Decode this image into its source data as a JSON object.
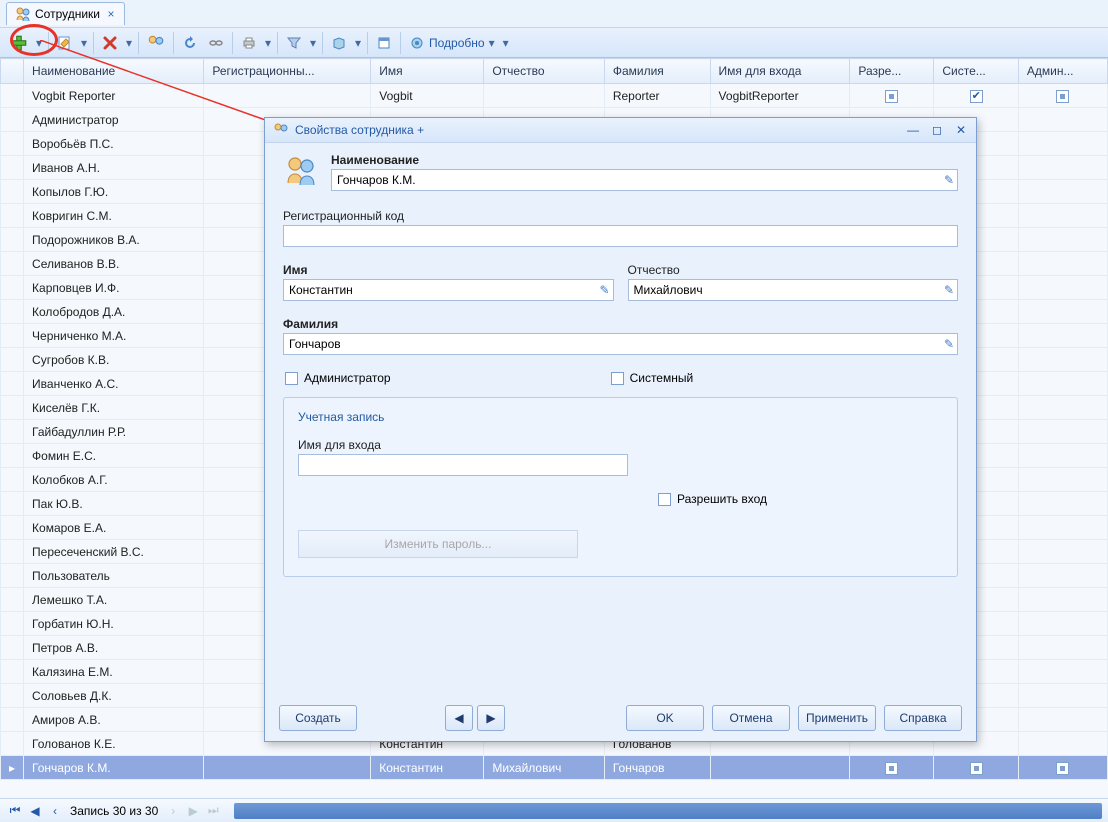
{
  "tab": {
    "label": "Сотрудники"
  },
  "toolbar": {
    "detail": "Подробно"
  },
  "columns": [
    "Наименование",
    "Регистрационны...",
    "Имя",
    "Отчество",
    "Фамилия",
    "Имя для входа",
    "Разре...",
    "Систе...",
    "Админ..."
  ],
  "rows": [
    {
      "name": "Vogbit Reporter",
      "reg": "",
      "fname": "Vogbit",
      "mname": "",
      "lname": "Reporter",
      "login": "VogbitReporter",
      "allow": "indet",
      "sys": "checked",
      "adm": "indet"
    },
    {
      "name": "Администратор"
    },
    {
      "name": "Воробьёв П.С."
    },
    {
      "name": "Иванов А.Н."
    },
    {
      "name": "Копылов Г.Ю."
    },
    {
      "name": "Ковригин С.М."
    },
    {
      "name": "Подорожников В.А."
    },
    {
      "name": "Селиванов В.В."
    },
    {
      "name": "Карповцев И.Ф."
    },
    {
      "name": "Колобродов Д.А."
    },
    {
      "name": "Черниченко М.А."
    },
    {
      "name": "Сугробов К.В."
    },
    {
      "name": "Иванченко А.С."
    },
    {
      "name": "Киселёв Г.К."
    },
    {
      "name": "Гайбадуллин Р.Р."
    },
    {
      "name": "Фомин Е.С."
    },
    {
      "name": "Колобков А.Г."
    },
    {
      "name": "Пак Ю.В."
    },
    {
      "name": "Комаров Е.А."
    },
    {
      "name": "Пересеченский В.С."
    },
    {
      "name": "Пользователь"
    },
    {
      "name": "Лемешко Т.А."
    },
    {
      "name": "Горбатин Ю.Н."
    },
    {
      "name": "Петров А.В."
    },
    {
      "name": "Калязина Е.М."
    },
    {
      "name": "Соловьев Д.К."
    },
    {
      "name": "Амиров А.В."
    },
    {
      "name": "Голованов К.Е.",
      "reg": "",
      "fname": "Константин",
      "mname": "",
      "lname": "Голованов",
      "login": ""
    },
    {
      "name": "Гончаров К.М.",
      "reg": "",
      "fname": "Константин",
      "mname": "Михайлович",
      "lname": "Гончаров",
      "login": "",
      "allow": "indet",
      "sys": "indet",
      "adm": "indet",
      "selected": true,
      "indicator": "▸"
    }
  ],
  "pager": {
    "text": "Запись 30 из 30"
  },
  "dialog": {
    "title": "Свойства сотрудника +",
    "labels": {
      "name": "Наименование",
      "reg": "Регистрационный код",
      "fname": "Имя",
      "mname": "Отчество",
      "lname": "Фамилия",
      "admin": "Администратор",
      "sys": "Системный",
      "account": "Учетная запись",
      "login": "Имя для входа",
      "allow": "Разрешить вход",
      "change_pw": "Изменить пароль..."
    },
    "values": {
      "name": "Гончаров К.М.",
      "reg": "",
      "fname": "Константин",
      "mname": "Михайлович",
      "lname": "Гончаров",
      "login": ""
    },
    "buttons": {
      "create": "Создать",
      "ok": "OK",
      "cancel": "Отмена",
      "apply": "Применить",
      "help": "Справка"
    }
  }
}
